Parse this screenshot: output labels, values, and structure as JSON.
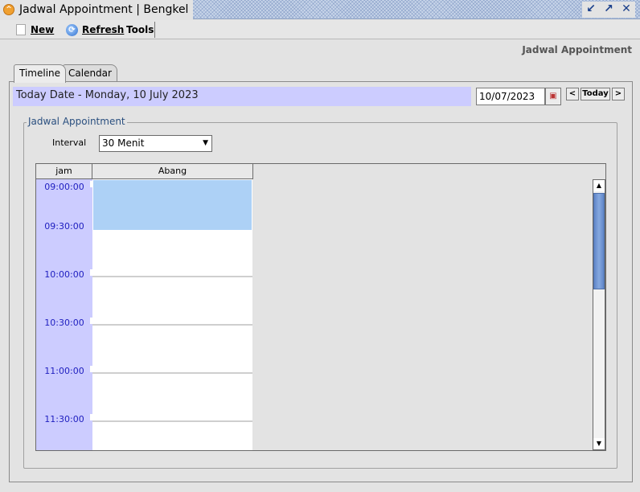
{
  "window": {
    "title": "Jadwal Appointment | Bengkel",
    "app_icon": "chevron-up-icon"
  },
  "toolbar": {
    "new_label": "New",
    "refresh_label": "Refresh",
    "tools_label": "Tools"
  },
  "header": {
    "title": "Jadwal Appointment"
  },
  "tabs": [
    {
      "label": "Timeline",
      "active": true
    },
    {
      "label": "Calendar",
      "active": false
    }
  ],
  "date_bar": {
    "today_text": "Today Date - Monday, 10 July 2023",
    "date_value": "10/07/2023",
    "prev_label": "<",
    "today_label": "Today",
    "next_label": ">"
  },
  "group": {
    "title": "Jadwal Appointment",
    "interval_label": "Interval",
    "interval_value": "30 Menit"
  },
  "schedule": {
    "columns": [
      "jam",
      "Abang"
    ],
    "times": [
      "09:00:00",
      "09:30:00",
      "10:00:00",
      "10:30:00",
      "11:00:00",
      "11:30:00"
    ],
    "booked_color": "#add1f6",
    "time_column_color": "#ccccff"
  }
}
